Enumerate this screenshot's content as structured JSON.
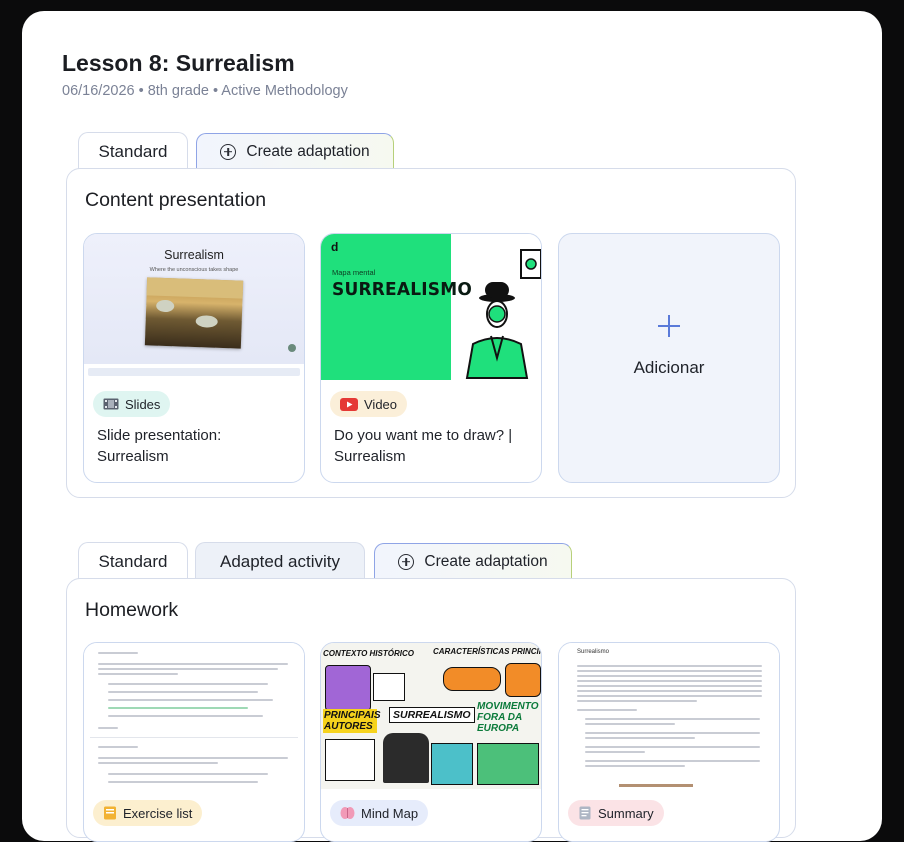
{
  "lesson": {
    "title": "Lesson 8: Surrealism",
    "meta": "06/16/2026 • 8th grade • Active Methodology"
  },
  "content_section": {
    "tabs": {
      "standard": "Standard",
      "create": "Create adaptation"
    },
    "title": "Content presentation",
    "cards": [
      {
        "badge": "Slides",
        "badge_icon": "film-icon",
        "badge_color": "#dff5f1",
        "title": "Slide presentation: Surrealism",
        "thumb": {
          "title": "Surrealism",
          "subtitle": "Where the unconscious takes shape"
        }
      },
      {
        "badge": "Video",
        "badge_icon": "youtube-icon",
        "badge_color": "#fbefd9",
        "title": "Do you want me to draw? | Surrealism",
        "thumb": {
          "logo": "d",
          "small": "Mapa mental",
          "big": "SURREALISMO"
        }
      }
    ],
    "add_label": "Adicionar"
  },
  "homework_section": {
    "tabs": {
      "standard": "Standard",
      "adapted": "Adapted activity",
      "create": "Create adaptation"
    },
    "title": "Homework",
    "cards": [
      {
        "badge": "Exercise list",
        "badge_icon": "notebook-icon",
        "badge_color": "#fcefcf"
      },
      {
        "badge": "Mind Map",
        "badge_icon": "brain-icon",
        "badge_color": "#e6ecfb",
        "thumb": {
          "t1": "CONTEXTO HISTÓRICO",
          "t2": "CARACTERÍSTICAS PRINCIPAIS",
          "t3": "PRINCIPAIS AUTORES",
          "t4": "SURREALISMO",
          "t5": "MOVIMENTO FORA DA EUROPA"
        }
      },
      {
        "badge": "Summary",
        "badge_icon": "document-icon",
        "badge_color": "#fbe3e6",
        "thumb": {
          "heading": "Surrealismo"
        }
      }
    ]
  },
  "colors": {
    "accent": "#5a7ad9",
    "border": "#d6dcea",
    "background": "#0b0b0c"
  }
}
